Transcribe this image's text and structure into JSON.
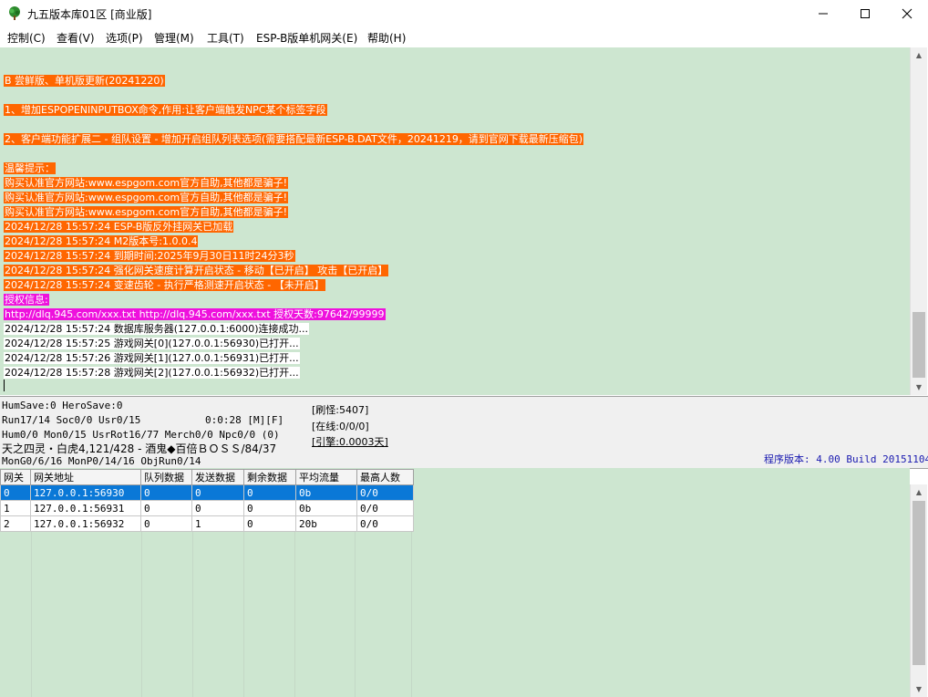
{
  "window": {
    "title": "九五版本库01区 [商业版]"
  },
  "menu": [
    {
      "label": "控制(C)"
    },
    {
      "label": "查看(V)"
    },
    {
      "label": "选项(P)"
    },
    {
      "label": "管理(M)"
    },
    {
      "label": "工具(T)"
    },
    {
      "label": "ESP-B版单机网关(E)"
    },
    {
      "label": "帮助(H)"
    }
  ],
  "log": [
    {
      "text": "B 尝鲜版、单机版更新(20241220)",
      "style": "orange"
    },
    {
      "text": "",
      "style": "none"
    },
    {
      "text": "1、增加ESPOPENINPUTBOX命令,作用:让客户端触发NPC某个标签字段",
      "style": "orange"
    },
    {
      "text": "",
      "style": "none"
    },
    {
      "text": "2、客户端功能扩展二 - 组队设置 - 增加开启组队列表选项(需要搭配最新ESP-B.DAT文件，20241219，请到官网下载最新压缩包)",
      "style": "orange"
    },
    {
      "text": "",
      "style": "none"
    },
    {
      "text": "温馨提示：",
      "style": "orange"
    },
    {
      "text": "购买认准官方网站:www.espgom.com官方自助,其他都是骗子!",
      "style": "orange"
    },
    {
      "text": "购买认准官方网站:www.espgom.com官方自助,其他都是骗子!",
      "style": "orange"
    },
    {
      "text": "购买认准官方网站:www.espgom.com官方自助,其他都是骗子!",
      "style": "orange"
    },
    {
      "text": "2024/12/28 15:57:24 ESP-B版反外挂网关已加载",
      "style": "orange"
    },
    {
      "text": "2024/12/28 15:57:24 M2版本号:1.0.0.4",
      "style": "orange"
    },
    {
      "text": "2024/12/28 15:57:24 到期时间:2025年9月30日11时24分3秒",
      "style": "orange"
    },
    {
      "text": "2024/12/28 15:57:24 强化网关速度计算开启状态 - 移动【已开启】 攻击【已开启】",
      "style": "orange"
    },
    {
      "text": "2024/12/28 15:57:24 变速齿轮 - 执行严格测速开启状态 - 【未开启】",
      "style": "orange"
    },
    {
      "text": "授权信息:",
      "style": "magenta"
    },
    {
      "text": "http://dlq.945.com/xxx.txt http://dlq.945.com/xxx.txt 授权天数:97642/99999",
      "style": "magenta"
    },
    {
      "text": "2024/12/28 15:57:24 数据库服务器(127.0.0.1:6000)连接成功...",
      "style": "white"
    },
    {
      "text": "2024/12/28 15:57:25 游戏网关[0](127.0.0.1:56930)已打开...",
      "style": "white"
    },
    {
      "text": "2024/12/28 15:57:26 游戏网关[1](127.0.0.1:56931)已打开...",
      "style": "white"
    },
    {
      "text": "2024/12/28 15:57:28 游戏网关[2](127.0.0.1:56932)已打开...",
      "style": "white"
    }
  ],
  "status": {
    "line1": "HumSave:0 HeroSave:0",
    "line2a": "Run17/14 Soc0/0 Usr0/15",
    "line2b": "0:0:28 [M][F]",
    "line3": "Hum0/0 Mon0/15 UsrRot16/77 Merch0/0 Npc0/0 (0)",
    "line4": "天之四灵・白虎4,121/428 - 酒鬼◆百倍ＢＯＳＳ/84/37",
    "line5": "MonG0/6/16 MonP0/14/16 ObjRun0/14",
    "refresh_monsters": "[刷怪:5407]",
    "online": "[在线:0/0/0]",
    "engine": "[引擎:0.0003天]",
    "version": "程序版本: 4.00 Build 20151104"
  },
  "gateway_table": {
    "columns": [
      "网关",
      "网关地址",
      "队列数据",
      "发送数据",
      "剩余数据",
      "平均流量",
      "最高人数"
    ],
    "rows": [
      [
        "0",
        "127.0.0.1:56930",
        "0",
        "0",
        "0",
        "0b",
        "0/0"
      ],
      [
        "1",
        "127.0.0.1:56931",
        "0",
        "0",
        "0",
        "0b",
        "0/0"
      ],
      [
        "2",
        "127.0.0.1:56932",
        "0",
        "1",
        "0",
        "20b",
        "0/0"
      ]
    ],
    "selected_row": 0
  },
  "colors": {
    "panel_bg": "#cde6d0",
    "highlight_orange": "#ff6600",
    "highlight_magenta": "#ee11dd",
    "selection_blue": "#0a78d7",
    "version_text": "#1a1ab0"
  },
  "icons": {
    "app": "tree-icon",
    "minimize": "minimize-icon",
    "maximize": "maximize-icon",
    "close": "close-icon",
    "scroll_up": "arrow-up-icon",
    "scroll_down": "arrow-down-icon"
  }
}
